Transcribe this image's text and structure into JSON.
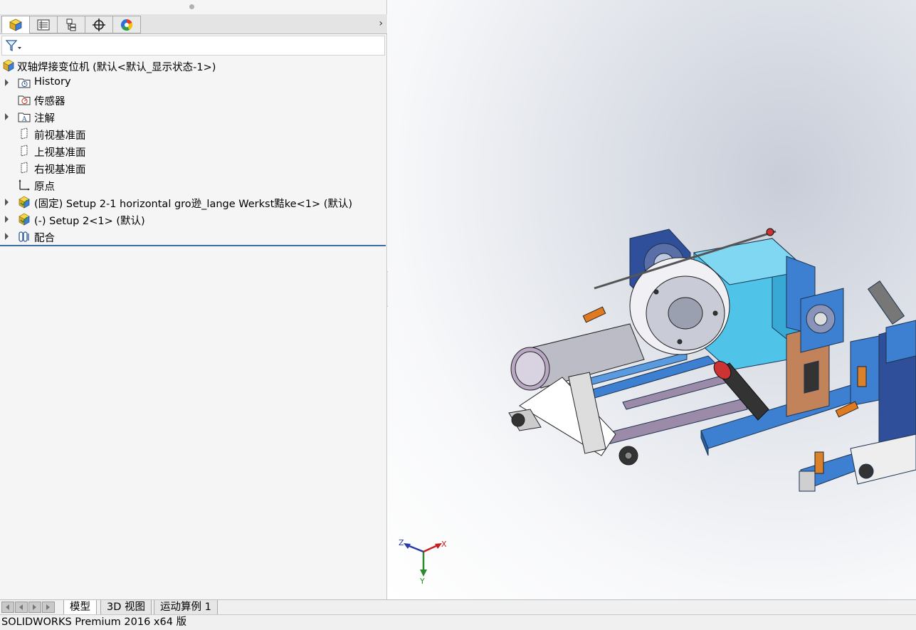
{
  "feature_manager": {
    "tabs": [
      {
        "name": "featuremanager-tab",
        "icon": "part-cube-icon"
      },
      {
        "name": "propertymanager-tab",
        "icon": "property-list-icon"
      },
      {
        "name": "configurationmanager-tab",
        "icon": "configuration-icon"
      },
      {
        "name": "dimxpert-tab",
        "icon": "crosshair-icon"
      },
      {
        "name": "display-manager-tab",
        "icon": "color-wheel-icon"
      }
    ],
    "more_glyph": "›",
    "filter_icon": "filter-funnel-icon",
    "tree": {
      "root": "双轴焊接变位机  (默认<默认_显示状态-1>)",
      "items": [
        {
          "label": "History",
          "icon": "history-folder-icon",
          "expandable": true
        },
        {
          "label": "传感器",
          "icon": "sensor-folder-icon",
          "expandable": false
        },
        {
          "label": "注解",
          "icon": "annotation-folder-icon",
          "expandable": true
        },
        {
          "label": "前视基准面",
          "icon": "plane-icon",
          "expandable": false
        },
        {
          "label": "上视基准面",
          "icon": "plane-icon",
          "expandable": false
        },
        {
          "label": "右视基准面",
          "icon": "plane-icon",
          "expandable": false
        },
        {
          "label": "原点",
          "icon": "origin-icon",
          "expandable": false
        },
        {
          "label": "(固定) Setup 2-1 horizontal gro逊_lange Werkst黠ke<1> (默认)",
          "icon": "subassembly-icon",
          "expandable": true
        },
        {
          "label": "(-) Setup 2<1> (默认)",
          "icon": "subassembly-icon",
          "expandable": true
        },
        {
          "label": "配合",
          "icon": "mates-icon",
          "expandable": true
        }
      ]
    }
  },
  "viewport": {
    "triad": {
      "x": "X",
      "y": "Y",
      "z": "Z"
    },
    "colors": {
      "frame_blue": "#3d7fd0",
      "body_cyan": "#4fc3e8",
      "plate_copper": "#c2825a",
      "pipe_grey": "#bcbcc6"
    }
  },
  "bottom_tabs": {
    "nav_buttons": [
      "first",
      "previous",
      "next",
      "last"
    ],
    "tabs": [
      "模型",
      "3D 视图",
      "运动算例 1"
    ],
    "active": "模型"
  },
  "status": {
    "text": "SOLIDWORKS Premium 2016 x64 版"
  }
}
